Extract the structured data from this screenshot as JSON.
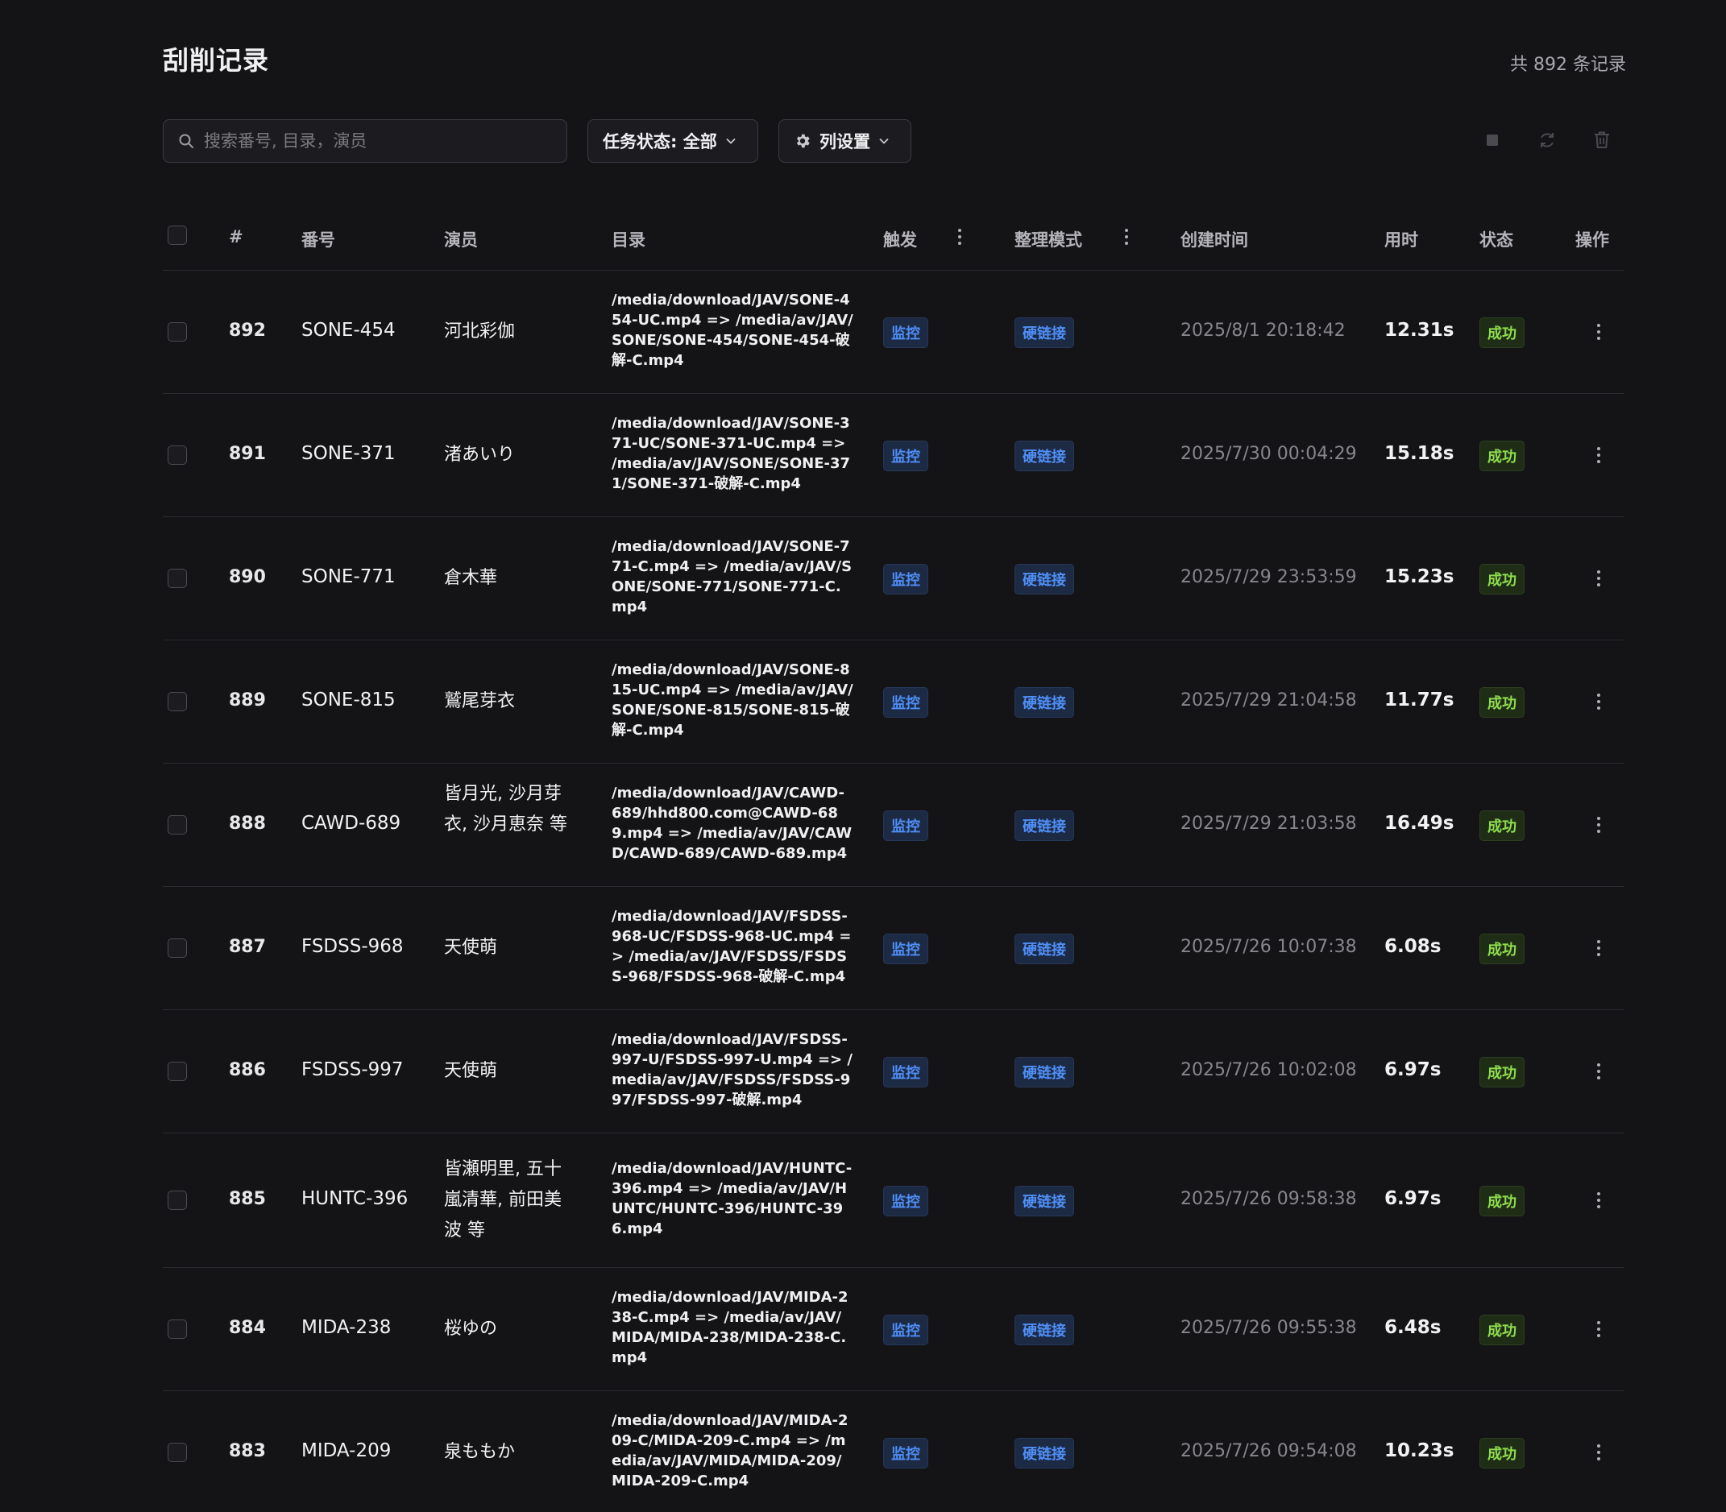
{
  "header": {
    "title": "刮削记录",
    "total": "共 892 条记录"
  },
  "toolbar": {
    "search_placeholder": "搜索番号, 目录，演员",
    "status_filter": "任务状态: 全部",
    "column_settings": "列设置"
  },
  "table": {
    "columns": {
      "index": "#",
      "code": "番号",
      "actor": "演员",
      "dir": "目录",
      "trigger": "触发",
      "mode": "整理模式",
      "created": "创建时间",
      "duration": "用时",
      "status": "状态",
      "ops": "操作"
    },
    "rows": [
      {
        "idx": "892",
        "code": "SONE-454",
        "actor": "河北彩伽",
        "dir": "/media/download/JAV/SONE-454-UC.mp4 => /media/av/JAV/SONE/SONE-454/SONE-454-破解-C.mp4",
        "trigger": "监控",
        "mode": "硬链接",
        "created": "2025/8/1 20:18:42",
        "duration": "12.31s",
        "status": "成功"
      },
      {
        "idx": "891",
        "code": "SONE-371",
        "actor": "渚あいり",
        "dir": "/media/download/JAV/SONE-371-UC/SONE-371-UC.mp4 => /media/av/JAV/SONE/SONE-371/SONE-371-破解-C.mp4",
        "trigger": "监控",
        "mode": "硬链接",
        "created": "2025/7/30 00:04:29",
        "duration": "15.18s",
        "status": "成功"
      },
      {
        "idx": "890",
        "code": "SONE-771",
        "actor": "倉木華",
        "dir": "/media/download/JAV/SONE-771-C.mp4 => /media/av/JAV/SONE/SONE-771/SONE-771-C.mp4",
        "trigger": "监控",
        "mode": "硬链接",
        "created": "2025/7/29 23:53:59",
        "duration": "15.23s",
        "status": "成功"
      },
      {
        "idx": "889",
        "code": "SONE-815",
        "actor": "鷲尾芽衣",
        "dir": "/media/download/JAV/SONE-815-UC.mp4 => /media/av/JAV/SONE/SONE-815/SONE-815-破解-C.mp4",
        "trigger": "监控",
        "mode": "硬链接",
        "created": "2025/7/29 21:04:58",
        "duration": "11.77s",
        "status": "成功"
      },
      {
        "idx": "888",
        "code": "CAWD-689",
        "actor": "皆月光, 沙月芽衣, 沙月恵奈 等",
        "dir": "/media/download/JAV/CAWD-689/hhd800.com@CAWD-689.mp4 => /media/av/JAV/CAWD/CAWD-689/CAWD-689.mp4",
        "trigger": "监控",
        "mode": "硬链接",
        "created": "2025/7/29 21:03:58",
        "duration": "16.49s",
        "status": "成功"
      },
      {
        "idx": "887",
        "code": "FSDSS-968",
        "actor": "天使萌",
        "dir": "/media/download/JAV/FSDSS-968-UC/FSDSS-968-UC.mp4 => /media/av/JAV/FSDSS/FSDSS-968/FSDSS-968-破解-C.mp4",
        "trigger": "监控",
        "mode": "硬链接",
        "created": "2025/7/26 10:07:38",
        "duration": "6.08s",
        "status": "成功"
      },
      {
        "idx": "886",
        "code": "FSDSS-997",
        "actor": "天使萌",
        "dir": "/media/download/JAV/FSDSS-997-U/FSDSS-997-U.mp4 => /media/av/JAV/FSDSS/FSDSS-997/FSDSS-997-破解.mp4",
        "trigger": "监控",
        "mode": "硬链接",
        "created": "2025/7/26 10:02:08",
        "duration": "6.97s",
        "status": "成功"
      },
      {
        "idx": "885",
        "code": "HUNTC-396",
        "actor": "皆瀬明里, 五十嵐清華, 前田美波 等",
        "dir": "/media/download/JAV/HUNTC-396.mp4 => /media/av/JAV/HUNTC/HUNTC-396/HUNTC-396.mp4",
        "trigger": "监控",
        "mode": "硬链接",
        "created": "2025/7/26 09:58:38",
        "duration": "6.97s",
        "status": "成功"
      },
      {
        "idx": "884",
        "code": "MIDA-238",
        "actor": "桜ゆの",
        "dir": "/media/download/JAV/MIDA-238-C.mp4 => /media/av/JAV/MIDA/MIDA-238/MIDA-238-C.mp4",
        "trigger": "监控",
        "mode": "硬链接",
        "created": "2025/7/26 09:55:38",
        "duration": "6.48s",
        "status": "成功"
      },
      {
        "idx": "883",
        "code": "MIDA-209",
        "actor": "泉ももか",
        "dir": "/media/download/JAV/MIDA-209-C/MIDA-209-C.mp4 => /media/av/JAV/MIDA/MIDA-209/MIDA-209-C.mp4",
        "trigger": "监控",
        "mode": "硬链接",
        "created": "2025/7/26 09:54:08",
        "duration": "10.23s",
        "status": "成功"
      }
    ]
  },
  "icons": {
    "search": "search-icon",
    "status_chevron": "chevron-down-icon",
    "settings": "gear-icon",
    "stop": "stop-icon",
    "refresh": "refresh-icon",
    "delete": "trash-icon",
    "more": "more-vertical-icon"
  },
  "colors": {
    "background": "#141417",
    "tag_blue": "#4f8ff7",
    "tag_green": "#8edc4e"
  }
}
